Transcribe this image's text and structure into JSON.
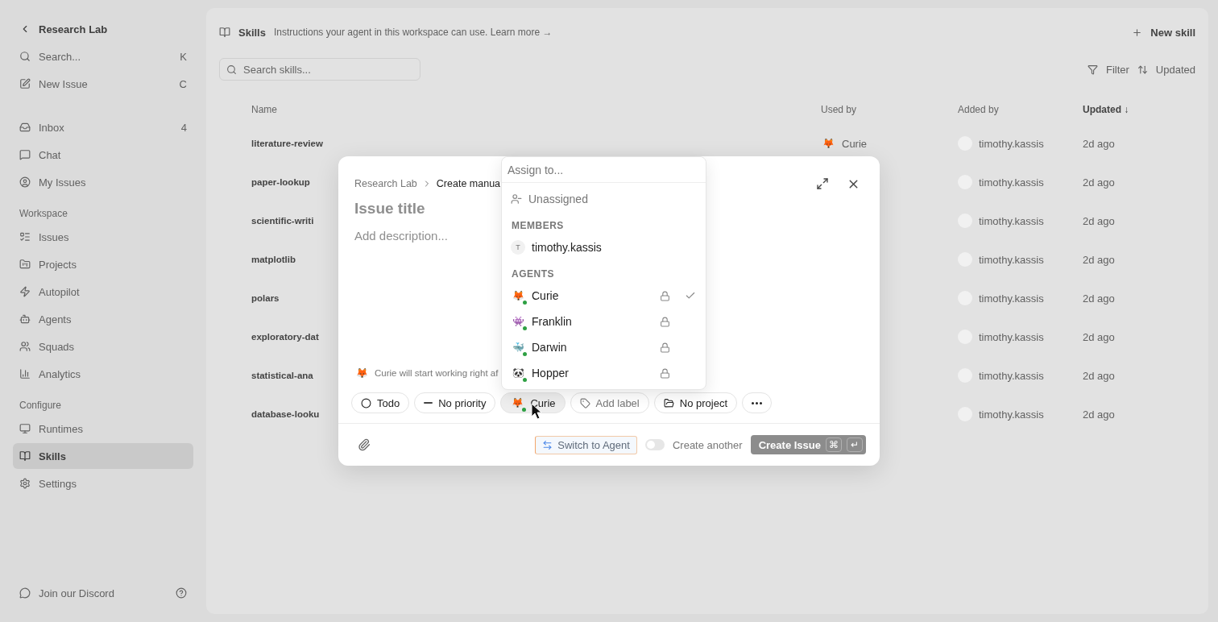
{
  "sidebar": {
    "workspace": "Research Lab",
    "top_items": [
      {
        "label": "Search...",
        "shortcut": "K",
        "kind": "search"
      },
      {
        "label": "New Issue",
        "shortcut": "C",
        "kind": "new"
      }
    ],
    "nav": [
      {
        "label": "Inbox",
        "badge": "4",
        "selected": false
      },
      {
        "label": "Chat",
        "selected": false
      },
      {
        "label": "My Issues",
        "selected": false
      }
    ],
    "sections": [
      {
        "title": "Workspace",
        "items": [
          {
            "label": "Issues",
            "selected": false
          },
          {
            "label": "Projects",
            "selected": false
          },
          {
            "label": "Autopilot",
            "selected": false
          },
          {
            "label": "Agents",
            "selected": false
          },
          {
            "label": "Squads",
            "selected": false
          },
          {
            "label": "Analytics",
            "selected": false
          }
        ]
      },
      {
        "title": "Configure",
        "items": [
          {
            "label": "Runtimes",
            "selected": false
          },
          {
            "label": "Skills",
            "selected": true
          },
          {
            "label": "Settings",
            "selected": false
          }
        ]
      }
    ],
    "footer": "Join our Discord"
  },
  "page": {
    "title": "Skills",
    "description": "Instructions your agent in this workspace can use. Learn more →",
    "new_button": "New skill",
    "search": {
      "placeholder": "Search skills..."
    },
    "filter": "Filter",
    "sort": "Updated",
    "table": {
      "columns": [
        "Name",
        "Used by",
        "Added by",
        "Updated ↓"
      ],
      "rows": [
        {
          "name": "literature-review",
          "used_by_emoji": "🦊",
          "used_by": "Curie",
          "added_by": "timothy.kassis",
          "updated": "2d ago"
        },
        {
          "name": "paper-lookup",
          "added_by": "timothy.kassis",
          "updated": "2d ago"
        },
        {
          "name": "scientific-writi",
          "added_by": "timothy.kassis",
          "updated": "2d ago"
        },
        {
          "name": "matplotlib",
          "added_by": "timothy.kassis",
          "updated": "2d ago"
        },
        {
          "name": "polars",
          "added_by": "timothy.kassis",
          "updated": "2d ago"
        },
        {
          "name": "exploratory-dat",
          "added_by": "timothy.kassis",
          "updated": "2d ago"
        },
        {
          "name": "statistical-ana",
          "added_by": "timothy.kassis",
          "updated": "2d ago"
        },
        {
          "name": "database-looku",
          "added_by": "timothy.kassis",
          "updated": "2d ago"
        }
      ]
    }
  },
  "dialog": {
    "breadcrumb": [
      "Research Lab",
      "Create manua"
    ],
    "title": {
      "placeholder": "Issue title"
    },
    "description": {
      "placeholder": "Add description..."
    },
    "hint": {
      "emoji": "🦊",
      "text": "Curie will start working right af"
    },
    "chips": [
      {
        "label": "Todo",
        "kind": "status"
      },
      {
        "label": "No priority",
        "kind": "priority"
      },
      {
        "label": "Curie",
        "kind": "assignee",
        "emoji": "🦊"
      },
      {
        "label": "Add label",
        "kind": "label"
      },
      {
        "label": "No project",
        "kind": "project"
      },
      {
        "kind": "more"
      }
    ],
    "switch_button": "Switch to Agent",
    "create_another": {
      "label": "Create another",
      "on": false
    },
    "create_button": "Create Issue",
    "shortcut_keys": [
      "⌘",
      "↵"
    ]
  },
  "assign_menu": {
    "search": {
      "placeholder": "Assign to..."
    },
    "unassigned": {
      "label": "Unassigned",
      "selected": false
    },
    "members_title": "MEMBERS",
    "members": [
      {
        "initial": "T",
        "name": "timothy.kassis",
        "selected": false
      }
    ],
    "agents_title": "AGENTS",
    "agents": [
      {
        "emoji": "🦊",
        "name": "Curie",
        "selected": true,
        "online": true
      },
      {
        "emoji": "👾",
        "name": "Franklin",
        "selected": false,
        "online": true
      },
      {
        "emoji": "🐳",
        "name": "Darwin",
        "selected": false,
        "online": true
      },
      {
        "emoji": "🐼",
        "name": "Hopper",
        "selected": false,
        "online": true
      }
    ]
  }
}
